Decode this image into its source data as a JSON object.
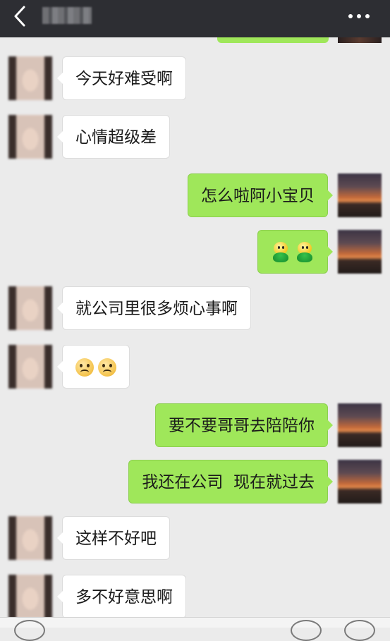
{
  "header": {
    "back_icon": "chevron-left-icon",
    "contact_name": "",
    "menu_icon": "more-dots-icon"
  },
  "colors": {
    "header_bg": "#2d2e33",
    "chat_bg": "#ebebeb",
    "outgoing_bubble": "#9fe75a",
    "incoming_bubble": "#ffffff"
  },
  "messages": [
    {
      "side": "in",
      "text": "今天好难受啊"
    },
    {
      "side": "in",
      "text": "心情超级差"
    },
    {
      "side": "out",
      "text": "怎么啦阿小宝贝"
    },
    {
      "side": "out",
      "emoji": [
        "sticker-guy-icon",
        "sticker-guy-icon"
      ]
    },
    {
      "side": "in",
      "text": "就公司里很多烦心事啊"
    },
    {
      "side": "in",
      "emoji": [
        "sad-face-icon",
        "sad-face-icon"
      ]
    },
    {
      "side": "out",
      "text": "要不要哥哥去陪陪你"
    },
    {
      "side": "out",
      "text": "我还在公司  现在就过去"
    },
    {
      "side": "in",
      "text": "这样不好吧"
    },
    {
      "side": "in",
      "text": "多不好意思啊"
    }
  ]
}
